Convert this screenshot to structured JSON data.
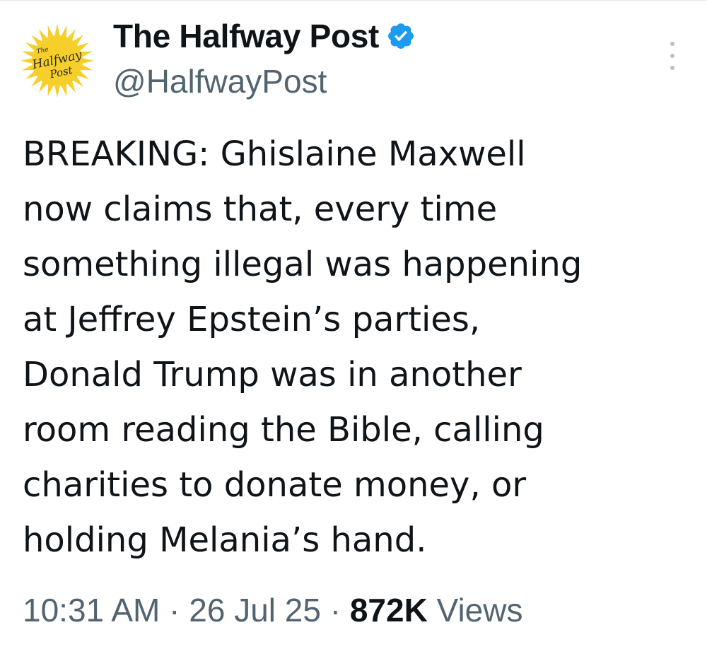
{
  "account": {
    "display_name": "The Halfway Post",
    "handle": "@HalfwayPost",
    "verified": true,
    "avatar_text_top": "The",
    "avatar_text_main": "Halfway",
    "avatar_text_bottom": "Post",
    "icons": {
      "avatar": "halfway-post-logo",
      "verified": "verified-badge-icon",
      "more": "more-options-icon"
    }
  },
  "tweet": {
    "lines": [
      "BREAKING: Ghislaine Maxwell",
      "now claims that, every time",
      "something illegal was happening",
      "at Jeffrey Epstein’s parties,",
      "Donald Trump was in another",
      "room reading the Bible, calling",
      "charities to donate money, or",
      "holding Melania’s hand."
    ]
  },
  "meta": {
    "time": "10:31 AM",
    "separator": "·",
    "date": "26 Jul 25",
    "views_count": "872K",
    "views_label": "Views"
  },
  "colors": {
    "text": "#0f1419",
    "secondary": "#536471",
    "verified_blue": "#1d9bf0",
    "avatar_yellow": "#f7cf2a",
    "divider": "#e6e6e6"
  }
}
